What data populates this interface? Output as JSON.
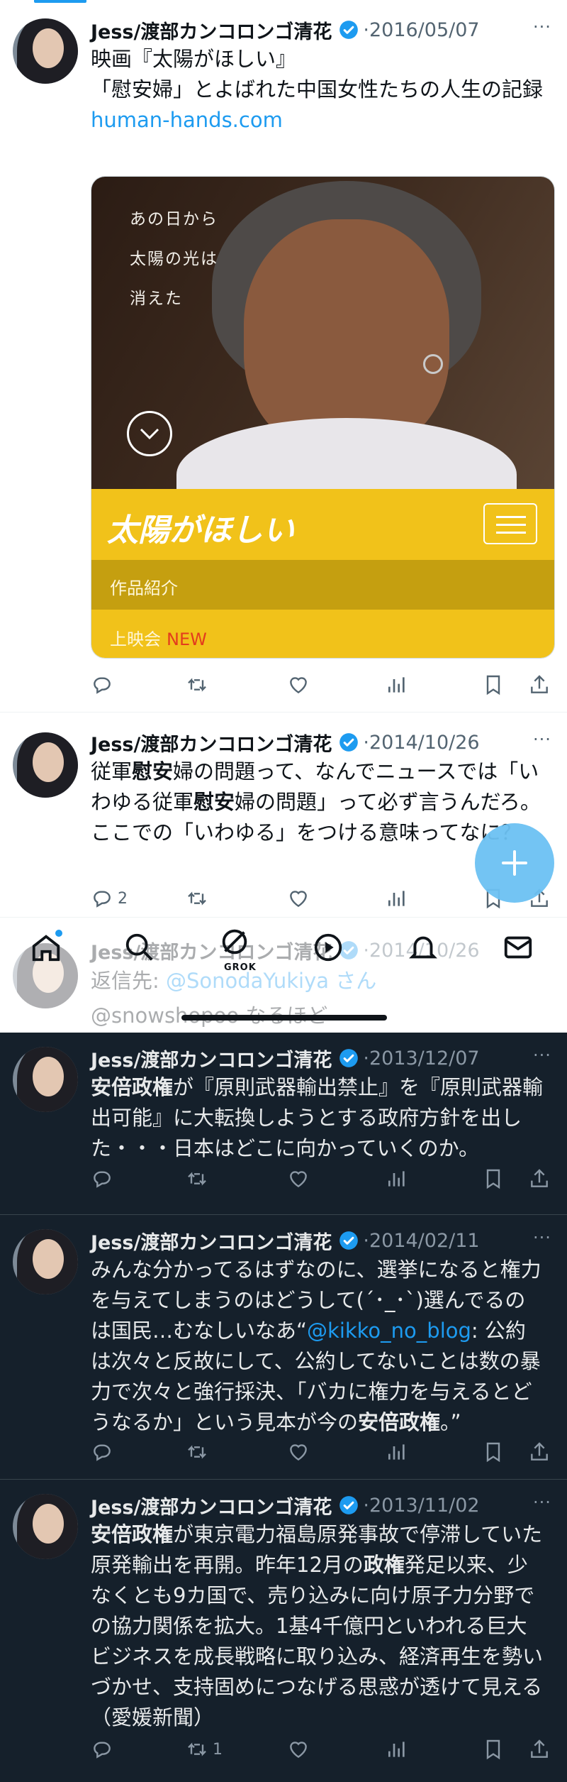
{
  "colors": {
    "accent": "#1d9bf0",
    "dark_bg": "#15202b",
    "card_yellow": "#f1c21a"
  },
  "tweets_light": [
    {
      "name": "Jess/渡部カンコロンゴ清花",
      "sep": "·",
      "date": "2016/05/07",
      "lines": [
        "映画『太陽がほしい』",
        "「慰安婦」とよばれた中国女性たちの人生の記録"
      ],
      "link": "human-hands.com",
      "card": {
        "vtext": [
          "あの日から",
          "太陽の光は",
          "消えた"
        ],
        "logo": "太陽がほしい",
        "menu1": "作品紹介",
        "menu2": "上映会",
        "menu2_badge": "NEW"
      },
      "actions": {
        "reply": "",
        "retweet": "",
        "like": ""
      }
    },
    {
      "name": "Jess/渡部カンコロンゴ清花",
      "sep": "·",
      "date": "2014/10/26",
      "text_a": "従軍",
      "text_b": "慰安",
      "text_c": "婦の問題って、なんでニュースでは「いわゆる従軍",
      "text_d": "慰安",
      "text_e": "婦の問題」って必ず言うんだろ。ここでの「いわゆる」をつける意味ってなに？",
      "actions": {
        "reply": "2",
        "retweet": "",
        "like": ""
      }
    },
    {
      "name": "Jess/渡部カンコロンゴ清花",
      "sep": "·",
      "date": "2014/10/26",
      "reply_prefix": "返信先: ",
      "reply_handle": "@SonodaYukiya さん",
      "partial": "@snowshopoo なるほど—"
    }
  ],
  "nav": {
    "grok_label": "GROK"
  },
  "tweets_dark": [
    {
      "name": "Jess/渡部カンコロンゴ清花",
      "sep": "·",
      "date": "2013/12/07",
      "bold1": "安倍政権",
      "text": "が『原則武器輸出禁止』を『原則武器輸出可能』に大転換しようとする政府方針を出した・・・日本はどこに向かっていくのか。",
      "actions": {
        "reply": "",
        "retweet": "",
        "like": ""
      }
    },
    {
      "name": "Jess/渡部カンコロンゴ清花",
      "sep": "·",
      "date": "2014/02/11",
      "text1": "みんな分かってるはずなのに、選挙になると権力を与えてしまうのはどうして(´･_･`)選んでるのは国民…むなしいなあ“",
      "mention": "@kikko_no_blog",
      "text2": ": 公約は次々と反故にして、公約してないことは数の暴力で次々と強行採決、「バカに権力を与えるとどうなるか」という見本が今の",
      "bold1": "安倍政権",
      "text3": "。”",
      "actions": {
        "reply": "",
        "retweet": "",
        "like": ""
      }
    },
    {
      "name": "Jess/渡部カンコロンゴ清花",
      "sep": "·",
      "date": "2013/11/02",
      "bold1": "安倍政権",
      "text1": "が東京電力福島原発事故で停滞していた原発輸出を再開。昨年12月の",
      "bold2": "政権",
      "text2": "発足以来、少なくとも9カ国で、売り込みに向け原子力分野での協力関係を拡大。1基4千億円といわれる巨大ビジネスを成長戦略に取り込み、経済再生を勢いづかせ、支持固めにつなげる思惑が透けて見える（愛媛新聞）",
      "actions": {
        "reply": "",
        "retweet": "1",
        "like": ""
      }
    }
  ]
}
